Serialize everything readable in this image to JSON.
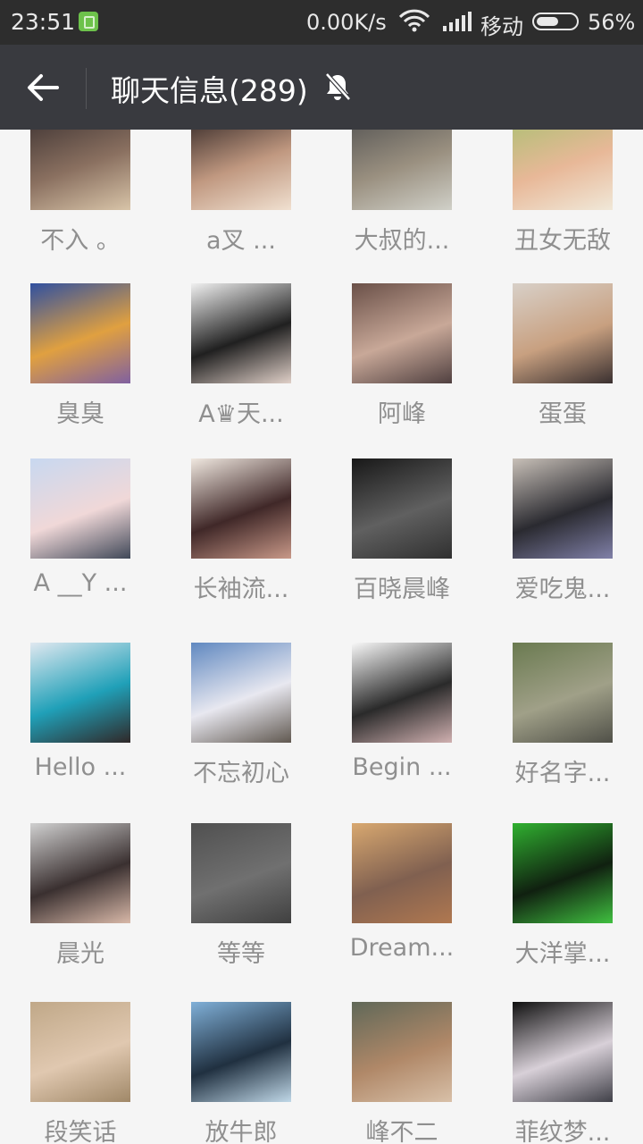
{
  "status_bar": {
    "time": "23:51",
    "speed": "0.00K/s",
    "carrier": "移动",
    "battery": "56%",
    "battery_level": 0.56
  },
  "header": {
    "title": "聊天信息(289)",
    "back_icon": "arrow-left-icon",
    "mute_icon": "bell-off-icon"
  },
  "members": [
    {
      "name": "不入 。",
      "colors": [
        "#3a3030",
        "#8a7060",
        "#d8c4a8"
      ]
    },
    {
      "name": "a叉  ...",
      "colors": [
        "#2a2020",
        "#c09880",
        "#f0e0d0"
      ]
    },
    {
      "name": "大叔的...",
      "colors": [
        "#505050",
        "#9a9080",
        "#d0d0c8"
      ]
    },
    {
      "name": "丑女无敌",
      "colors": [
        "#a8c070",
        "#e8b898",
        "#f0e8d8"
      ]
    },
    {
      "name": "臭臭",
      "colors": [
        "#3050a0",
        "#e0a040",
        "#8060a0"
      ]
    },
    {
      "name": "A♛天...",
      "colors": [
        "#f0f0f0",
        "#202020",
        "#e0d0c8"
      ]
    },
    {
      "name": "阿峰",
      "colors": [
        "#6a5048",
        "#c8a898",
        "#504040"
      ]
    },
    {
      "name": "蛋蛋",
      "colors": [
        "#d8d0c8",
        "#c8a080",
        "#3a3030"
      ]
    },
    {
      "name": "A __Y ...",
      "colors": [
        "#c8d8f0",
        "#f0d8d8",
        "#404858"
      ]
    },
    {
      "name": "长袖流...",
      "colors": [
        "#f0e8e0",
        "#402828",
        "#c89888"
      ]
    },
    {
      "name": "百晓晨峰",
      "colors": [
        "#181818",
        "#606060",
        "#303030"
      ]
    },
    {
      "name": "爱吃鬼...",
      "colors": [
        "#c8c0b8",
        "#2a2a30",
        "#8080a8"
      ]
    },
    {
      "name": "Hello  ...",
      "colors": [
        "#e0e8f0",
        "#20a0b8",
        "#302828"
      ]
    },
    {
      "name": "不忘初心",
      "colors": [
        "#6088c0",
        "#e8e8f0",
        "#605850"
      ]
    },
    {
      "name": "Begin ...",
      "colors": [
        "#f8f8f8",
        "#2a2a2a",
        "#d0b0b0"
      ]
    },
    {
      "name": "好名字...",
      "colors": [
        "#6a7a50",
        "#a0a088",
        "#505048"
      ]
    },
    {
      "name": "晨光",
      "colors": [
        "#d0d0d0",
        "#3a3030",
        "#d8b8a8"
      ]
    },
    {
      "name": "等等",
      "colors": [
        "#505050",
        "#707070",
        "#404040"
      ]
    },
    {
      "name": "Dream...",
      "colors": [
        "#d8a870",
        "#806050",
        "#b07850"
      ]
    },
    {
      "name": "大洋掌...",
      "colors": [
        "#30b030",
        "#102010",
        "#40c040"
      ]
    },
    {
      "name": "段笑话",
      "colors": [
        "#c0a888",
        "#e0c8b0",
        "#a08868"
      ]
    },
    {
      "name": "放牛郎",
      "colors": [
        "#80b0d8",
        "#203040",
        "#c0d8e8"
      ]
    },
    {
      "name": "峰不二",
      "colors": [
        "#606858",
        "#b08868",
        "#d8c0a8"
      ]
    },
    {
      "name": "菲纹梦...",
      "colors": [
        "#101010",
        "#d8d0d8",
        "#404048"
      ]
    }
  ]
}
